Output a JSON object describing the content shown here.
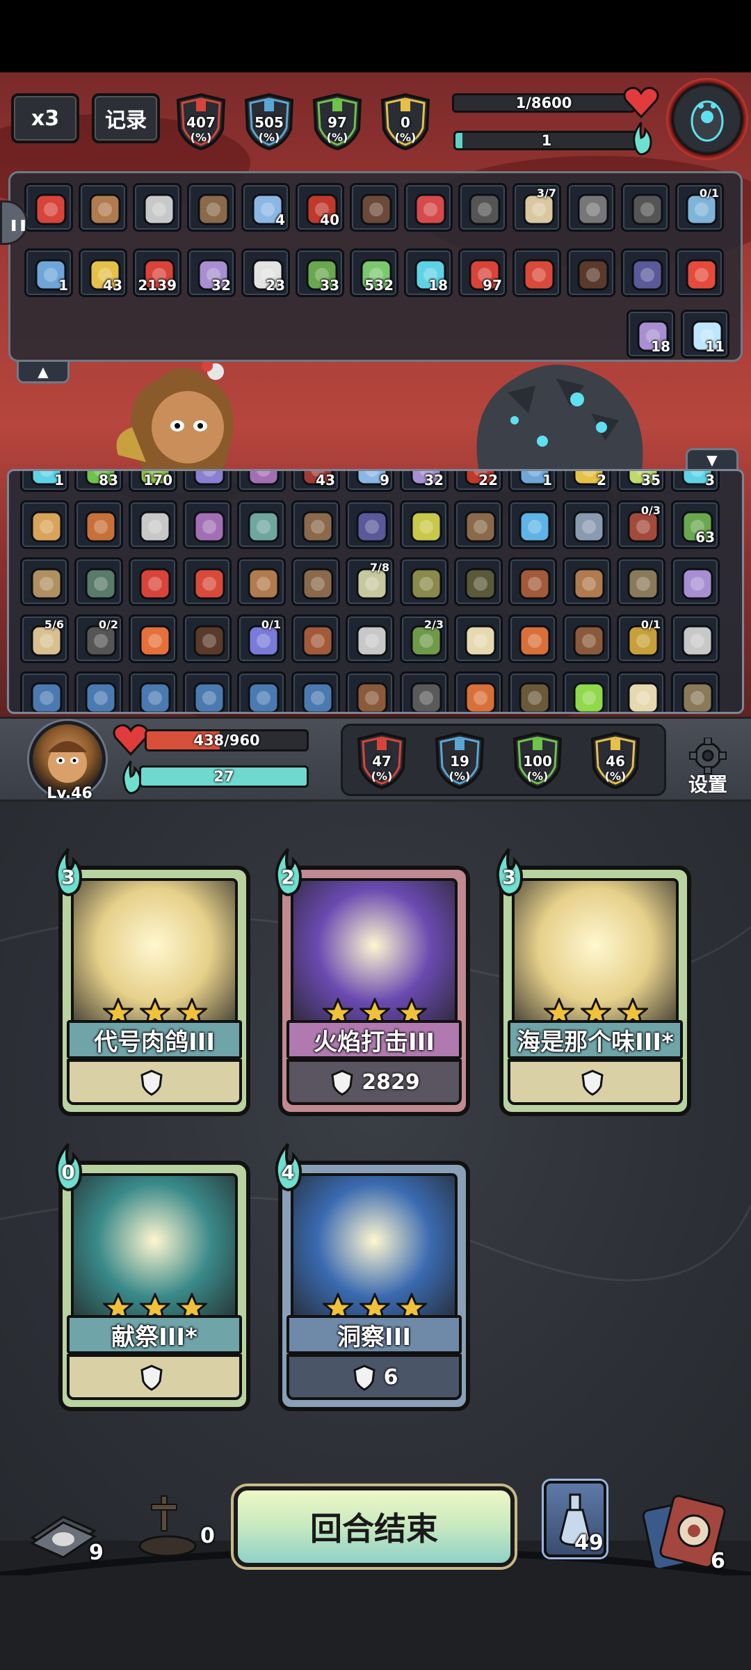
{
  "hud": {
    "speed_label": "x3",
    "record_label": "记录",
    "enemy_stats": [
      {
        "value": "407",
        "unit": "(%)",
        "color": "#d9443a"
      },
      {
        "value": "505",
        "unit": "(%)",
        "color": "#5aa7d6"
      },
      {
        "value": "97",
        "unit": "(%)",
        "color": "#6fc24a"
      },
      {
        "value": "0",
        "unit": "(%)",
        "color": "#e6c14a"
      }
    ],
    "boss_hp_text": "1/8600",
    "boss_hp_fraction": 0.0001,
    "boss_energy_text": "1",
    "boss_energy_fraction": 0.04
  },
  "relics": {
    "row1": [
      {
        "icon": "flame-bird-icon",
        "color": "#d9443a"
      },
      {
        "icon": "helmet-icon",
        "color": "#b07b4e"
      },
      {
        "icon": "wings-icon",
        "color": "#c8c8c8"
      },
      {
        "icon": "owl-icon",
        "color": "#8a6a4a"
      },
      {
        "icon": "crystal-ball-icon",
        "color": "#8bb7e6",
        "count": "4"
      },
      {
        "icon": "red-arrow-down-icon",
        "color": "#c0392b",
        "count": "40"
      },
      {
        "icon": "book-icon",
        "color": "#6b4a3a"
      },
      {
        "icon": "red-monster-icon",
        "color": "#d64a4a"
      },
      {
        "icon": "arrows-icon",
        "color": "#555"
      },
      {
        "icon": "clock-icon",
        "color": "#d9c7a0",
        "fraction": "3/7"
      },
      {
        "icon": "shell-icon",
        "color": "#777"
      },
      {
        "icon": "umbrella-icon",
        "color": "#555"
      },
      {
        "icon": "ring-icon",
        "color": "#7fb4d9",
        "fraction": "0/1"
      }
    ],
    "row2": [
      {
        "icon": "shield-icon",
        "color": "#6fa6d9",
        "count": "1"
      },
      {
        "icon": "lightning-icon",
        "color": "#e6c14a",
        "count": "43"
      },
      {
        "icon": "fire-icon",
        "color": "#d9443a",
        "count": "2139"
      },
      {
        "icon": "vortex-icon",
        "color": "#a88fd1",
        "count": "32"
      },
      {
        "icon": "paper-icon",
        "color": "#e3e3e3",
        "count": "23"
      },
      {
        "icon": "poison-icon",
        "color": "#6aa84f",
        "count": "33"
      },
      {
        "icon": "skull-icon",
        "color": "#7bc96f",
        "count": "532"
      },
      {
        "icon": "target-icon",
        "color": "#5fd3e6",
        "count": "18"
      },
      {
        "icon": "slash-icon",
        "color": "#d9443a",
        "count": "97"
      },
      {
        "icon": "sausage-icon",
        "color": "#d94a3a"
      },
      {
        "icon": "glove-icon",
        "color": "#5a3a2a"
      },
      {
        "icon": "armor-icon",
        "color": "#5a5a9a"
      },
      {
        "icon": "strawberry-icon",
        "color": "#e64a3a"
      }
    ],
    "row3": [
      {
        "icon": "strength-icon",
        "color": "#a88fd1",
        "count": "18"
      },
      {
        "icon": "snowflake-icon",
        "color": "#bfe6ff",
        "count": "11"
      }
    ]
  },
  "inventory": {
    "row0": [
      {
        "icon": "ghost-icon",
        "color": "#5fd3e6",
        "count": "1"
      },
      {
        "icon": "clover-icon",
        "color": "#6fc24a",
        "count": "83"
      },
      {
        "icon": "leaf-icon",
        "color": "#8fbf4a",
        "count": "170"
      },
      {
        "icon": "vortex-icon",
        "color": "#8a7fd1"
      },
      {
        "icon": "rune-icon",
        "color": "#a36fb4"
      },
      {
        "icon": "slash-icon",
        "color": "#a33a36",
        "count": "43"
      },
      {
        "icon": "lightning-icon",
        "color": "#8ab7e6",
        "count": "9"
      },
      {
        "icon": "vortex-icon",
        "color": "#a88fd1",
        "count": "32"
      },
      {
        "icon": "red-arrow-down-icon",
        "color": "#c0392b",
        "count": "22"
      },
      {
        "icon": "shield-icon",
        "color": "#6fa6d9",
        "count": "1"
      },
      {
        "icon": "lightning-icon",
        "color": "#e6c14a",
        "count": "2"
      },
      {
        "icon": "spores-icon",
        "color": "#bfd96f",
        "count": "35"
      },
      {
        "icon": "ghost-icon",
        "color": "#5fd3e6",
        "count": "3"
      }
    ],
    "row1": [
      {
        "icon": "bone-icon",
        "color": "#d9a45a"
      },
      {
        "icon": "gear-icon",
        "color": "#c8703a"
      },
      {
        "icon": "mask-icon",
        "color": "#c8c8c8"
      },
      {
        "icon": "potion-icon",
        "color": "#a36fb4"
      },
      {
        "icon": "fish-icon",
        "color": "#6fa6a0"
      },
      {
        "icon": "snail-icon",
        "color": "#8a6a4a"
      },
      {
        "icon": "armor-icon",
        "color": "#5a5a9a"
      },
      {
        "icon": "feather-icon",
        "color": "#c8c84a"
      },
      {
        "icon": "owl-icon",
        "color": "#8a6a4a"
      },
      {
        "icon": "water-drop-icon",
        "color": "#5fb4e6"
      },
      {
        "icon": "dagger-icon",
        "color": "#8a9ab0"
      },
      {
        "icon": "scroll-icon",
        "color": "#a34a3a",
        "fraction": "0/3"
      },
      {
        "icon": "poison-icon",
        "color": "#6aa84f",
        "count": "63"
      }
    ],
    "row2": [
      {
        "icon": "hourglass-icon",
        "color": "#b09060"
      },
      {
        "icon": "goblet-icon",
        "color": "#5a7a6a"
      },
      {
        "icon": "flame-bird-icon",
        "color": "#d9443a"
      },
      {
        "icon": "sausage-icon",
        "color": "#d94a3a"
      },
      {
        "icon": "helmet-icon",
        "color": "#b07b4e"
      },
      {
        "icon": "drum-icon",
        "color": "#8a6a4a"
      },
      {
        "icon": "claw-icon",
        "color": "#c8c8a0",
        "fraction": "7/8"
      },
      {
        "icon": "fungus-icon",
        "color": "#8a8a4a"
      },
      {
        "icon": "bomb-icon",
        "color": "#5a5a3a"
      },
      {
        "icon": "meat-icon",
        "color": "#a35a3a"
      },
      {
        "icon": "beehive-icon",
        "color": "#b07b4e"
      },
      {
        "icon": "broom-icon",
        "color": "#8a7a5a"
      },
      {
        "icon": "egg-icon",
        "color": "#a88fd1"
      }
    ],
    "row3": [
      {
        "icon": "map-icon",
        "color": "#d9c090",
        "fraction": "5/6"
      },
      {
        "icon": "boot-icon",
        "color": "#555",
        "fraction": "0/2"
      },
      {
        "icon": "fruit-icon",
        "color": "#e6703a"
      },
      {
        "icon": "glove-icon",
        "color": "#5a3a2a"
      },
      {
        "icon": "planet-icon",
        "color": "#7a7ad9",
        "fraction": "0/1"
      },
      {
        "icon": "meat-icon",
        "color": "#a35a3a"
      },
      {
        "icon": "ghost-hand-icon",
        "color": "#c8c8c8"
      },
      {
        "icon": "goblin-icon",
        "color": "#6f9a4a",
        "fraction": "2/3"
      },
      {
        "icon": "ice-cream-icon",
        "color": "#e6d9b0"
      },
      {
        "icon": "tablet-icon",
        "color": "#d9703a"
      },
      {
        "icon": "fist-icon",
        "color": "#8a5a3a"
      },
      {
        "icon": "lantern-icon",
        "color": "#c8a03a",
        "fraction": "0/1"
      },
      {
        "icon": "wings-icon",
        "color": "#c8c8c8"
      }
    ],
    "row4": [
      {
        "icon": "rune-icon",
        "color": "#4a7ab0"
      },
      {
        "icon": "rune-icon",
        "color": "#4a7ab0"
      },
      {
        "icon": "rune-icon",
        "color": "#4a7ab0"
      },
      {
        "icon": "rune-icon",
        "color": "#4a7ab0"
      },
      {
        "icon": "rune-icon",
        "color": "#4a7ab0"
      },
      {
        "icon": "rune-icon",
        "color": "#4a7ab0"
      },
      {
        "icon": "figure-icon",
        "color": "#8a5a3a"
      },
      {
        "icon": "orb-icon",
        "color": "#5a5a5a"
      },
      {
        "icon": "fire-icon",
        "color": "#d9703a"
      },
      {
        "icon": "bag-icon",
        "color": "#6a5a3a"
      },
      {
        "icon": "slime-icon",
        "color": "#8fd94a"
      },
      {
        "icon": "bottle-icon",
        "color": "#e6d9b0"
      },
      {
        "icon": "helmet-icon",
        "color": "#8a7a5a"
      }
    ]
  },
  "player": {
    "level_text": "Lv.46",
    "hp_text": "438/960",
    "hp_fraction": 0.456,
    "energy_text": "27",
    "energy_fraction": 1.0,
    "stats": [
      {
        "value": "47",
        "unit": "(%)",
        "color": "#d9443a"
      },
      {
        "value": "19",
        "unit": "(%)",
        "color": "#5aa7d6"
      },
      {
        "value": "100",
        "unit": "(%)",
        "color": "#6fc24a"
      },
      {
        "value": "46",
        "unit": "(%)",
        "color": "#e6c14a"
      }
    ],
    "settings_label": "设置"
  },
  "hand": [
    {
      "cost": "3",
      "name": "代号肉鸽III",
      "desc": "",
      "desc_icon": "up-arrow-icon",
      "frame_color": "#b8d3a0",
      "art_color": "#e6d08a",
      "name_bg": "#6fa4a8",
      "desc_bg": "#d9d0a6",
      "stars": 3
    },
    {
      "cost": "2",
      "name": "火焰打击III",
      "desc": "2829",
      "desc_icon": "fist-icon",
      "frame_color": "#c08a90",
      "art_color": "#6a4ab0",
      "name_bg": "#b07ab0",
      "desc_bg": "#5a5560",
      "stars": 3
    },
    {
      "cost": "3",
      "name": "海是那个味III*",
      "desc": "",
      "desc_icon": "gear-icon",
      "frame_color": "#b8d3a0",
      "art_color": "#e6d08a",
      "name_bg": "#6fa4a8",
      "desc_bg": "#d9d0a6",
      "stars": 3
    },
    {
      "cost": "0",
      "name": "献祭III*",
      "desc": "",
      "desc_icon": "gear-icon",
      "frame_color": "#b8d3a0",
      "art_color": "#3a8a8a",
      "name_bg": "#6fa4a8",
      "desc_bg": "#d9d0a6",
      "stars": 3
    },
    {
      "cost": "4",
      "name": "洞察III",
      "desc": "6",
      "desc_icon": "shield-icon",
      "frame_color": "#8aa0b8",
      "art_color": "#3a6ab0",
      "name_bg": "#6f8aa8",
      "desc_bg": "#4a5568",
      "stars": 3
    }
  ],
  "bottom": {
    "draw_pile": "9",
    "exhaust_pile": "0",
    "end_turn_label": "回合结束",
    "potion_count": "49",
    "discard_pile": "6"
  }
}
